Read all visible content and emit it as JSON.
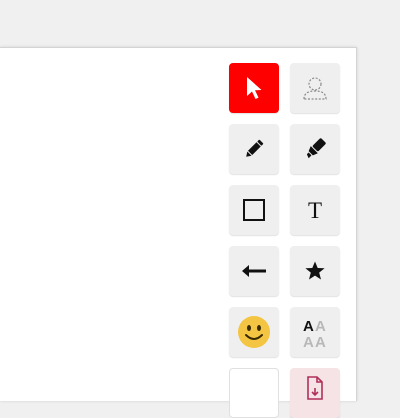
{
  "toolbar": {
    "tools": [
      {
        "name": "select",
        "icon": "cursor-arrow-icon",
        "active": true
      },
      {
        "name": "erase-selection",
        "icon": "dashed-user-icon"
      },
      {
        "name": "pencil",
        "icon": "pencil-icon"
      },
      {
        "name": "highlighter",
        "icon": "highlighter-icon"
      },
      {
        "name": "rectangle",
        "icon": "rectangle-icon"
      },
      {
        "name": "text",
        "icon": "text-icon",
        "label": "T"
      },
      {
        "name": "arrow",
        "icon": "arrow-left-icon"
      },
      {
        "name": "stamp-star",
        "icon": "star-icon"
      },
      {
        "name": "emoji",
        "icon": "smiley-icon"
      },
      {
        "name": "font-style",
        "icon": "font-style-icon"
      },
      {
        "name": "color",
        "icon": "blank-swatch-icon"
      },
      {
        "name": "export",
        "icon": "document-icon"
      }
    ],
    "colors": {
      "active": "#ff0000",
      "button": "#efefef",
      "icon": "#111111",
      "emoji": "#f4c542",
      "export": "#f6e3e5",
      "export_icon": "#b0305a"
    }
  }
}
